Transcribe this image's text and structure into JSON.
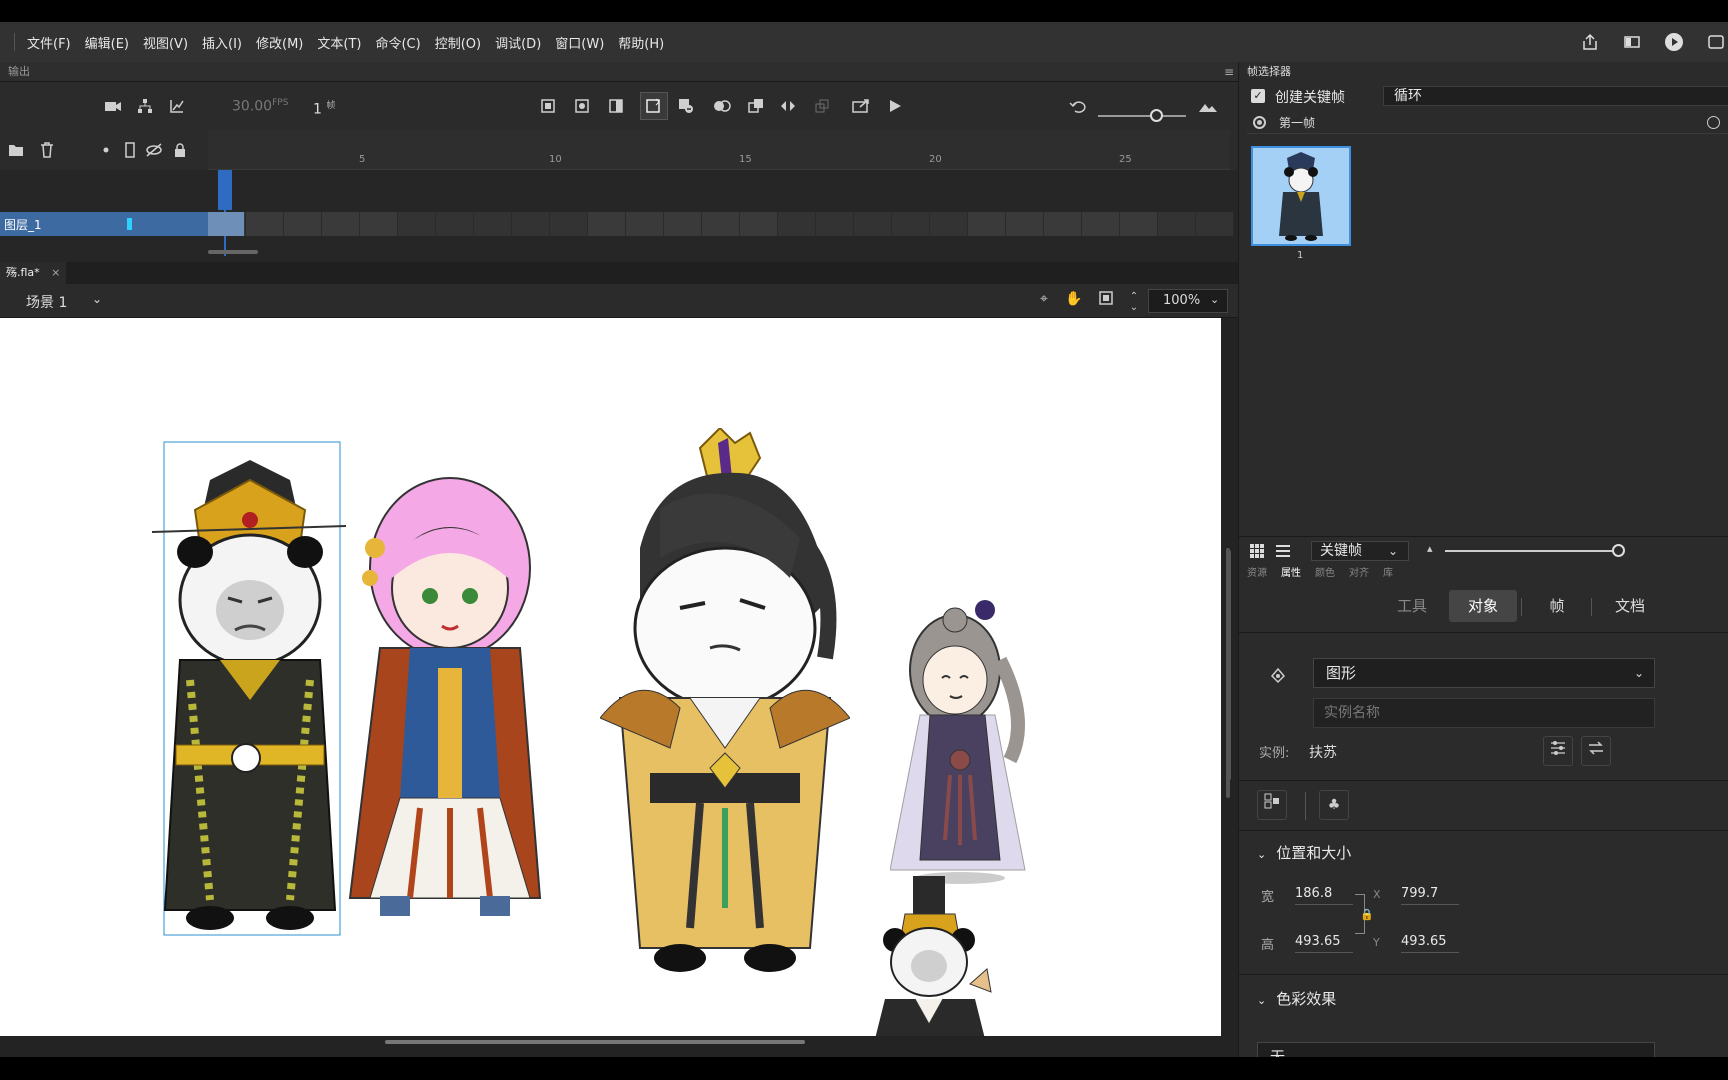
{
  "menu": {
    "items": [
      "文件(F)",
      "编辑(E)",
      "视图(V)",
      "插入(I)",
      "修改(M)",
      "文本(T)",
      "命令(C)",
      "控制(O)",
      "调试(D)",
      "窗口(W)",
      "帮助(H)"
    ]
  },
  "output_panel": {
    "title": "输出"
  },
  "timeline": {
    "fps": "30.00",
    "fps_unit": "FPS",
    "current_frame": "1",
    "frame_unit": "帧",
    "ruler_labels": [
      "5",
      "10",
      "15",
      "20",
      "25"
    ],
    "layer_name": "图层_1"
  },
  "document": {
    "tab_name": "殇.fla*",
    "tab_close": "×",
    "scene": "场景 1",
    "zoom": "100%"
  },
  "frame_picker": {
    "title": "帧选择器",
    "create_keyframe_label": "创建关键帧",
    "loop_mode": "循环",
    "first_frame_label": "第一帧",
    "thumbnail_number": "1"
  },
  "library_toolbar": {
    "view_select": "关键帧"
  },
  "properties": {
    "tabs": [
      "资源",
      "属性",
      "颜色",
      "对齐",
      "库"
    ],
    "seg_tabs": [
      "工具",
      "对象",
      "帧",
      "文档"
    ],
    "symbol_type": "图形",
    "instance_name_placeholder": "实例名称",
    "instance_label": "实例:",
    "instance_value": "扶苏",
    "position_section": "位置和大小",
    "width_label": "宽",
    "width_value": "186.8",
    "height_label": "高",
    "height_value": "493.65",
    "x_label": "X",
    "x_value": "799.7",
    "y_label": "Y",
    "y_value": "493.65",
    "color_section": "色彩效果",
    "color_effect": "无"
  },
  "icons": {
    "share": "share-icon",
    "panel": "panel-icon",
    "play": "play-icon"
  }
}
